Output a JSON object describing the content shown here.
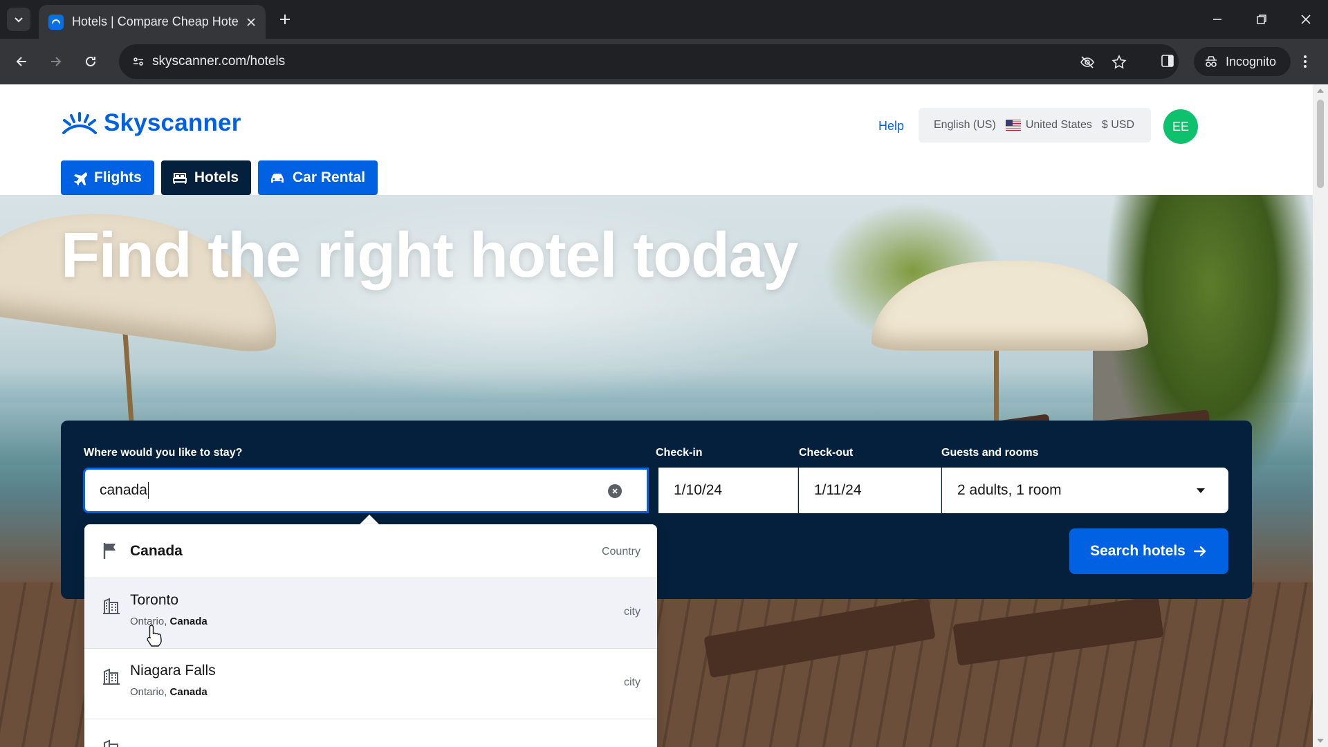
{
  "browser": {
    "tab_title": "Hotels | Compare Cheap Hotel",
    "url": "skyscanner.com/hotels",
    "incognito_label": "Incognito"
  },
  "header": {
    "brand": "Skyscanner",
    "help": "Help",
    "language": "English (US)",
    "country": "United States",
    "currency": "$ USD",
    "avatar_initials": "EE"
  },
  "nav": {
    "tabs": [
      {
        "label": "Flights",
        "active": false
      },
      {
        "label": "Hotels",
        "active": true
      },
      {
        "label": "Car Rental",
        "active": false
      }
    ]
  },
  "hero": {
    "title": "Find the right hotel today"
  },
  "search": {
    "destination_label": "Where would you like to stay?",
    "destination_value": "canada",
    "checkin_label": "Check-in",
    "checkin_value": "1/10/24",
    "checkout_label": "Check-out",
    "checkout_value": "1/11/24",
    "guests_label": "Guests and rooms",
    "guests_value": "2 adults, 1 room",
    "button_label": "Search hotels"
  },
  "autocomplete": {
    "items": [
      {
        "name": "Canada",
        "sub_region": "",
        "sub_country": "",
        "type": "Country",
        "icon": "flag-icon"
      },
      {
        "name": "Toronto",
        "sub_region": "Ontario, ",
        "sub_country": "Canada",
        "type": "city",
        "icon": "building-icon"
      },
      {
        "name": "Niagara Falls",
        "sub_region": "Ontario, ",
        "sub_country": "Canada",
        "type": "city",
        "icon": "building-icon"
      }
    ]
  },
  "colors": {
    "brand_blue": "#0062e3",
    "navy": "#05203c",
    "avatar_green": "#0ec16d"
  }
}
